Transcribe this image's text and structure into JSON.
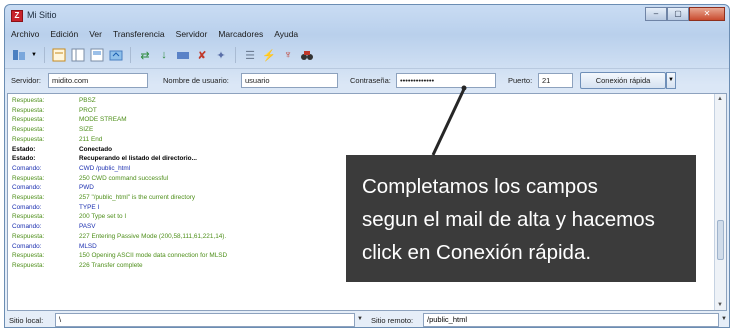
{
  "window": {
    "title": "Mi Sitio",
    "controls": [
      "–",
      "▢",
      "✕"
    ]
  },
  "menu": [
    "Archivo",
    "Edición",
    "Ver",
    "Transferencia",
    "Servidor",
    "Marcadores",
    "Ayuda"
  ],
  "toolbar_icons": [
    "site-manager-icon",
    "dropdown-icon",
    "log-toggle-icon",
    "tree-toggle-icon",
    "local-tree-icon",
    "queue-icon",
    "refresh-icon",
    "process-queue-icon",
    "cancel-icon",
    "disconnect-icon",
    "reconnect-icon",
    "filter-icon",
    "compare-icon",
    "sync-browse-icon",
    "search-icon",
    "binoculars-icon"
  ],
  "quickconnect": {
    "host_label": "Servidor:",
    "host_value": "midito.com",
    "user_label": "Nombre de usuario:",
    "user_value": "usuario",
    "password_label": "Contraseña:",
    "password_value": "•••••••••••••",
    "port_label": "Puerto:",
    "port_value": "21",
    "button_label": "Conexión rápida",
    "colors": {
      "response": "#4e8f1a",
      "command": "#1b2fb0",
      "status": "#000000"
    }
  },
  "log": [
    {
      "type": "Respuesta:",
      "msg": "PBSZ",
      "kind": "resp"
    },
    {
      "type": "Respuesta:",
      "msg": "PROT",
      "kind": "resp"
    },
    {
      "type": "Respuesta:",
      "msg": "MODE STREAM",
      "kind": "resp"
    },
    {
      "type": "Respuesta:",
      "msg": "SIZE",
      "kind": "resp"
    },
    {
      "type": "Respuesta:",
      "msg": "211 End",
      "kind": "resp"
    },
    {
      "type": "Estado:",
      "msg": "Conectado",
      "kind": "status"
    },
    {
      "type": "Estado:",
      "msg": "Recuperando el listado del directorio...",
      "kind": "status"
    },
    {
      "type": "Comando:",
      "msg": "CWD /public_html",
      "kind": "cmd"
    },
    {
      "type": "Respuesta:",
      "msg": "250 CWD command successful",
      "kind": "resp"
    },
    {
      "type": "Comando:",
      "msg": "PWD",
      "kind": "cmd"
    },
    {
      "type": "Respuesta:",
      "msg": "257 \"/public_html\" is the current directory",
      "kind": "resp"
    },
    {
      "type": "Comando:",
      "msg": "TYPE I",
      "kind": "cmd"
    },
    {
      "type": "Respuesta:",
      "msg": "200 Type set to I",
      "kind": "resp"
    },
    {
      "type": "Comando:",
      "msg": "PASV",
      "kind": "cmd"
    },
    {
      "type": "Respuesta:",
      "msg": "227 Entering Passive Mode (200,58,111,61,221,14).",
      "kind": "resp"
    },
    {
      "type": "Comando:",
      "msg": "MLSD",
      "kind": "cmd"
    },
    {
      "type": "Respuesta:",
      "msg": "150 Opening ASCII mode data connection for MLSD",
      "kind": "resp"
    },
    {
      "type": "Respuesta:",
      "msg": "226 Transfer complete",
      "kind": "resp"
    }
  ],
  "callout": {
    "lines": [
      "Completamos los campos",
      "segun el mail de alta y hacemos",
      "click en Conexión rápida."
    ],
    "color": "#262626"
  },
  "sitebar": {
    "local_label": "Sitio local:",
    "local_value": "\\",
    "remote_label": "Sitio remoto:",
    "remote_value": "/public_html"
  }
}
